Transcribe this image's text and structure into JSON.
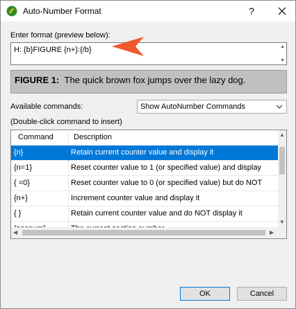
{
  "window": {
    "title": "Auto-Number Format",
    "help_label": "?",
    "close_icon": "close-icon"
  },
  "format": {
    "label": "Enter format (preview below):",
    "value": "H: {b}FIGURE {n+}:{/b}"
  },
  "preview": {
    "bold_text": "FIGURE 1:",
    "text": "The quick brown fox jumps over the lazy dog."
  },
  "commands": {
    "label": "Available commands:",
    "dropdown_value": "Show AutoNumber Commands",
    "hint": "(Double-click command to insert)"
  },
  "table": {
    "columns": [
      "Command",
      "Description"
    ],
    "rows": [
      {
        "cmd": "{n}",
        "desc": "Retain current counter value and display it"
      },
      {
        "cmd": "{n=1}",
        "desc": "Reset counter value to 1 (or specified value) and display"
      },
      {
        "cmd": "{ =0}",
        "desc": "Reset counter value to 0 (or specified value) but do NOT"
      },
      {
        "cmd": "{n+}",
        "desc": "Increment counter value and display it"
      },
      {
        "cmd": "{ }",
        "desc": "Retain current counter value and do NOT display it"
      },
      {
        "cmd": "{secnum}",
        "desc": "The current section number"
      }
    ]
  },
  "buttons": {
    "ok": "OK",
    "cancel": "Cancel"
  },
  "colors": {
    "selection": "#0078d7",
    "callout": "#f05a2a",
    "preview_bg": "#c0c0c0"
  }
}
